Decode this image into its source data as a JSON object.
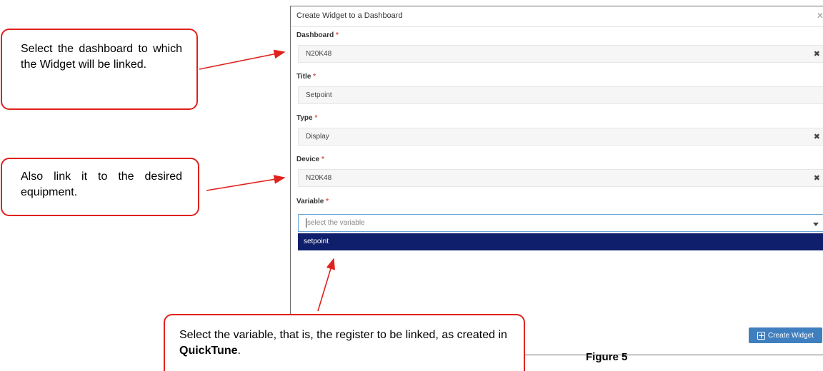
{
  "dialog": {
    "title": "Create Widget to a Dashboard",
    "close_icon": "close-icon"
  },
  "fields": {
    "dashboard": {
      "label": "Dashboard",
      "required_mark": "*",
      "value": "N20K48"
    },
    "title": {
      "label": "Title",
      "required_mark": "*",
      "value": "Setpoint"
    },
    "type": {
      "label": "Type",
      "required_mark": "*",
      "value": "Display"
    },
    "device": {
      "label": "Device",
      "required_mark": "*",
      "value": "N20K48"
    },
    "variable": {
      "label": "Variable",
      "required_mark": "*",
      "placeholder": "select the variable",
      "options": [
        "setpoint"
      ]
    }
  },
  "actions": {
    "create_label": "Create Widget"
  },
  "callouts": {
    "dashboard": "Select the dashboard to which the Widget will be linked.",
    "device": "Also link it to the desired equipment.",
    "variable_prefix": "Select the variable, that is, the register to be linked, as created in ",
    "variable_bold": "QuickTune",
    "variable_suffix": "."
  },
  "caption": "Figure 5",
  "colors": {
    "callout_border": "#e0211c",
    "option_highlight": "#101f6b",
    "button": "#3f7fbf",
    "required": "#d9534f"
  }
}
